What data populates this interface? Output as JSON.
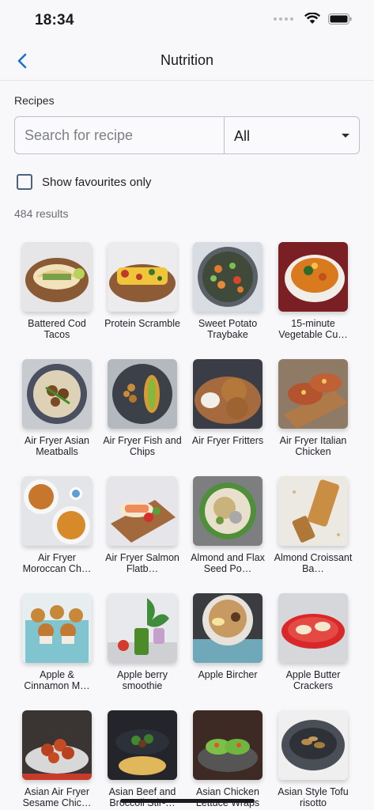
{
  "status": {
    "time": "18:34"
  },
  "nav": {
    "title": "Nutrition"
  },
  "recipes": {
    "label": "Recipes",
    "search_placeholder": "Search for recipe",
    "filter_value": "All",
    "fav_label": "Show favourites only",
    "results": "484 results"
  },
  "items": [
    {
      "label": "Battered Cod Tacos",
      "icon": "tacos"
    },
    {
      "label": "Protein Scramble",
      "icon": "scramble"
    },
    {
      "label": "Sweet Potato Traybake",
      "icon": "traybake"
    },
    {
      "label": "15-minute Vegetable Cu…",
      "icon": "curry"
    },
    {
      "label": "Air Fryer Asian Meatballs",
      "icon": "meatballs"
    },
    {
      "label": "Air Fryer Fish and Chips",
      "icon": "fish-chips"
    },
    {
      "label": "Air Fryer Fritters",
      "icon": "fritters"
    },
    {
      "label": "Air Fryer Italian Chicken",
      "icon": "chicken"
    },
    {
      "label": "Air Fryer Moroccan Ch…",
      "icon": "moroccan"
    },
    {
      "label": "Air Fryer Salmon Flatb…",
      "icon": "salmon"
    },
    {
      "label": "Almond and Flax Seed Po…",
      "icon": "porridge"
    },
    {
      "label": "Almond Croissant Ba…",
      "icon": "bake"
    },
    {
      "label": "Apple & Cinnamon M…",
      "icon": "muffins"
    },
    {
      "label": "Apple berry smoothie",
      "icon": "smoothie"
    },
    {
      "label": "Apple Bircher",
      "icon": "bircher"
    },
    {
      "label": "Apple Butter Crackers",
      "icon": "crackers"
    },
    {
      "label": "Asian Air Fryer Sesame Chic…",
      "icon": "sesame"
    },
    {
      "label": "Asian Beef and Broccoli Stir-…",
      "icon": "stirfry"
    },
    {
      "label": "Asian Chicken Lettuce Wraps",
      "icon": "wraps"
    },
    {
      "label": "Asian Style Tofu risotto",
      "icon": "risotto"
    }
  ]
}
